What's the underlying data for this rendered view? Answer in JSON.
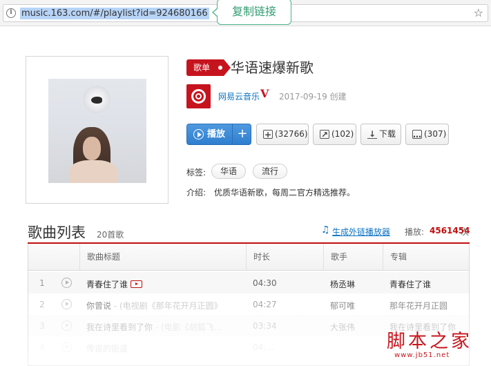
{
  "browser": {
    "url": "music.163.com/#/playlist?id=924680166",
    "copy_bubble": "复制链接"
  },
  "playlist": {
    "tag": "歌单",
    "title": "华语速爆新歌",
    "creator": "网易云音乐",
    "creator_badge": "V",
    "created": "2017-09-19 创建"
  },
  "actions": {
    "play": "播放",
    "add": "+",
    "favorite": "(32766)",
    "share": "(102)",
    "download": "下载",
    "comment": "(307)"
  },
  "tags": {
    "label": "标签:",
    "items": [
      "华语",
      "流行"
    ]
  },
  "intro": {
    "label": "介绍:",
    "text": "优质华语新歌，每周二官方精选推荐。"
  },
  "song_list": {
    "title": "歌曲列表",
    "count": "20首歌",
    "external_player": "生成外链播放器",
    "play_count_label": "播放:",
    "play_count": "4561454",
    "play_count_unit": "次",
    "columns": [
      "歌曲标题",
      "时长",
      "歌手",
      "专辑"
    ],
    "rows": [
      {
        "num": "1",
        "title": "青春住了谁",
        "sub": "",
        "dur": "04:30",
        "artist": "杨丞琳",
        "album": "青春住了谁"
      },
      {
        "num": "2",
        "title": "你曾说",
        "sub": " - (电视剧《那年花开月正圆》",
        "dur": "04:27",
        "artist": "郁可唯",
        "album": "那年花开月正圆"
      },
      {
        "num": "3",
        "title": "我在诗里看到了你",
        "sub": " - (电影《胡狐飞...",
        "dur": "03:34",
        "artist": "大张伟",
        "album": "我在诗里看到了你"
      },
      {
        "num": "4",
        "title": "传说的街道",
        "sub": "",
        "dur": "04:...",
        "artist": "",
        "album": ""
      }
    ]
  },
  "watermark": {
    "text": "脚本之家",
    "url": "www.jb51.net"
  }
}
